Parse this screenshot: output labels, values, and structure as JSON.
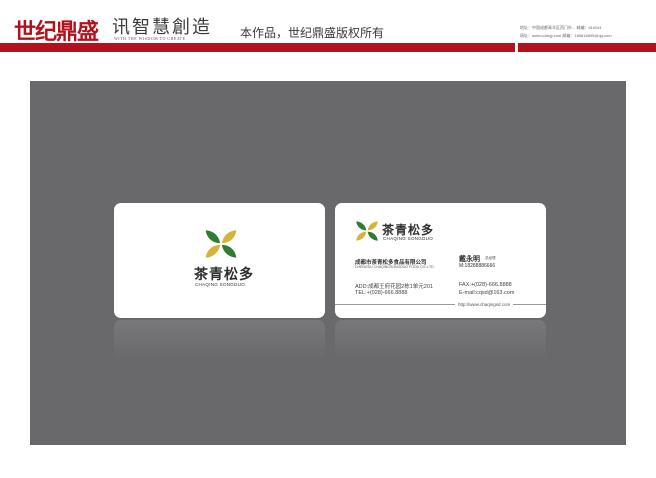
{
  "header": {
    "brand": "世纪鼎盛",
    "slogan": "讯智慧創造",
    "slogan_en": "WITH THE WISDOM TO CREATE",
    "tagline": "本作品，世纪鼎盛版权所有",
    "contact_line1": "地址：中国成都青羊区西门外...  邮编：610041",
    "contact_line2": "网址：www.cddsjy.com   邮箱：185818895@qq.com"
  },
  "colors": {
    "brand_red": "#b3121d",
    "stage_gray": "#69696b",
    "leaf_green": "#2e7d32",
    "leaf_yellow": "#d4b53a"
  },
  "card_front": {
    "logo_icon": "leaf-logo-icon",
    "name": "茶青松多",
    "pinyin": "CHAQING SONGDUO"
  },
  "card_back": {
    "logo_icon": "leaf-logo-icon",
    "name": "茶青松多",
    "pinyin": "CHAQING SONGDUO",
    "company_cn": "成都市茶青松多食品有限公司",
    "company_en": "CHENGDU CHAQINGSONGDUO FOOD CO.,LTD",
    "person_name": "戴永明",
    "person_title": "总经理",
    "mobile": "M:18288886666",
    "address": "ADD:成都王府花园2栋1单元201",
    "tel": "TEL:+(028)-666.8888",
    "fax": "FAX:+(028)-666.8888",
    "email": "E-mail:cqsd@163.com",
    "website": "http://www.chaqingsd.com"
  }
}
